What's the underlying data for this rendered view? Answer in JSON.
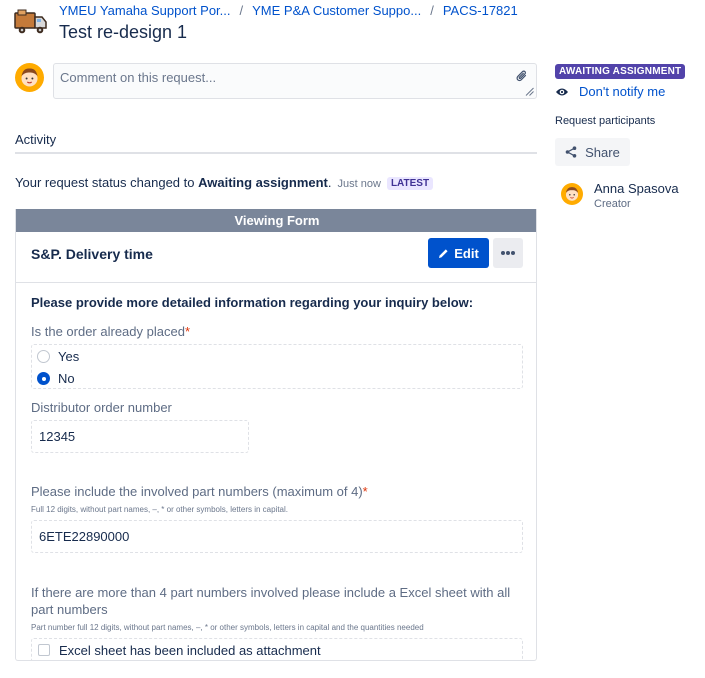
{
  "breadcrumb": {
    "items": [
      "YMEU Yamaha Support Por...",
      "YME P&A Customer Suppo...",
      "PACS-17821"
    ],
    "separator": "/"
  },
  "page_title": "Test re-design 1",
  "comment": {
    "placeholder": "Comment on this request..."
  },
  "activity": {
    "heading": "Activity",
    "status_prefix": "Your request status changed to ",
    "status_value": "Awaiting assignment",
    "status_suffix": ".",
    "time": "Just now",
    "latest_badge": "LATEST"
  },
  "form": {
    "header": "Viewing Form",
    "title": "S&P. Delivery time",
    "edit_label": "Edit",
    "intro": "Please provide more detailed information regarding your inquiry below:",
    "q1_label": "Is the order already placed",
    "q1_options": [
      {
        "label": "Yes",
        "selected": false
      },
      {
        "label": "No",
        "selected": true
      }
    ],
    "q2_label": "Distributor order number",
    "q2_value": "12345",
    "q3_label": "Please include the involved part numbers (maximum of 4)",
    "q3_hint": "Full 12 digits, without part names, –, * or other symbols, letters in capital.",
    "q3_value": "6ETE22890000",
    "q4_label": "If there are more than 4 part numbers involved please include a Excel sheet with all part numbers",
    "q4_hint": "Part number full 12 digits, without part names, –, * or other symbols, letters in capital and the quantities needed",
    "q4_checkbox_label": "Excel sheet has been included as attachment",
    "required_mark": "*"
  },
  "sidebar": {
    "status_badge": "AWAITING ASSIGNMENT",
    "notify_label": "Don't notify me",
    "participants_label": "Request participants",
    "share_label": "Share",
    "participant": {
      "name": "Anna Spasova",
      "role": "Creator"
    }
  },
  "colors": {
    "accent": "#0052cc",
    "status_badge": "#5243aa",
    "form_header": "#7a869a",
    "required": "#de350b"
  },
  "icons": [
    "delivery-truck-icon",
    "user-avatar-icon",
    "paperclip-icon",
    "eye-icon",
    "share-icon",
    "pencil-icon",
    "more-icon"
  ]
}
